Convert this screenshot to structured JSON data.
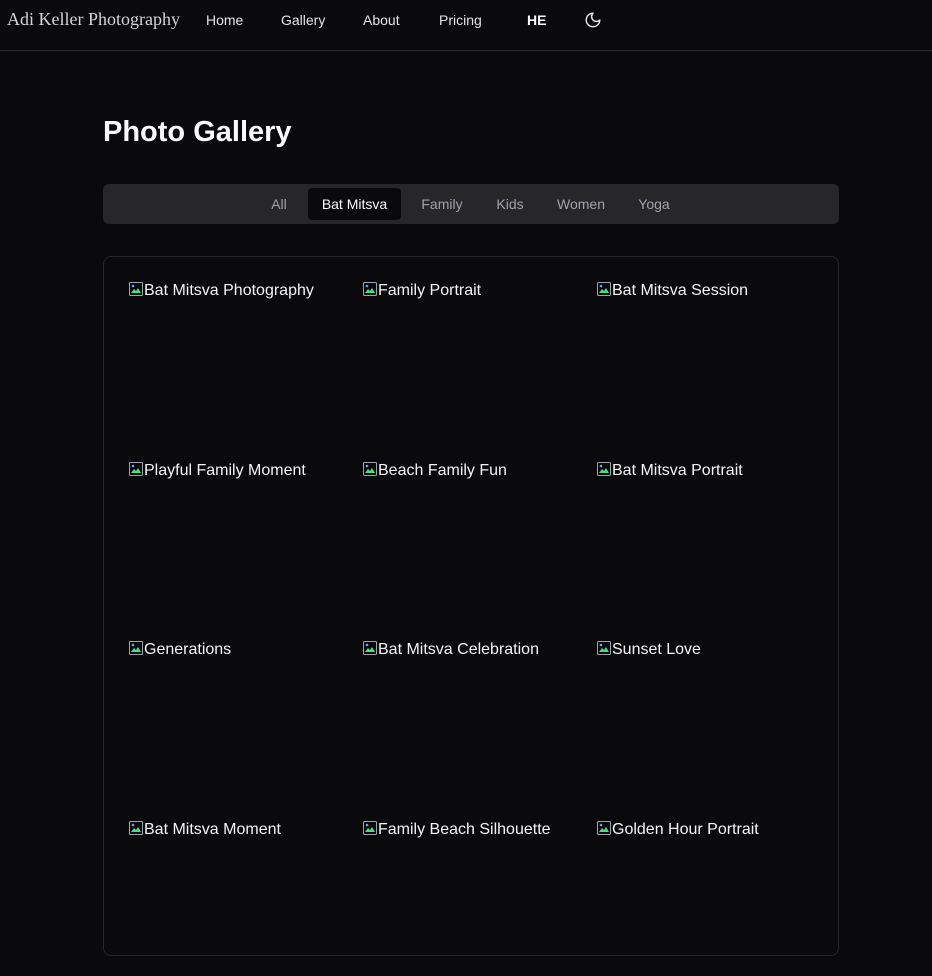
{
  "brand": "Adi Keller Photography",
  "nav": {
    "links": [
      "Home",
      "Gallery",
      "About",
      "Pricing"
    ],
    "lang": "HE",
    "theme_icon": "moon-icon"
  },
  "page": {
    "title": "Photo Gallery"
  },
  "filters": {
    "tabs": [
      "All",
      "Bat Mitsva",
      "Family",
      "Kids",
      "Women",
      "Yoga"
    ],
    "active": "Bat Mitsva"
  },
  "gallery": {
    "items": [
      {
        "alt": "Bat Mitsva Photography"
      },
      {
        "alt": "Family Portrait"
      },
      {
        "alt": "Bat Mitsva Session"
      },
      {
        "alt": "Playful Family Moment"
      },
      {
        "alt": "Beach Family Fun"
      },
      {
        "alt": "Bat Mitsva Portrait"
      },
      {
        "alt": "Generations"
      },
      {
        "alt": "Bat Mitsva Celebration"
      },
      {
        "alt": "Sunset Love"
      },
      {
        "alt": "Bat Mitsva Moment"
      },
      {
        "alt": "Family Beach Silhouette"
      },
      {
        "alt": "Golden Hour Portrait"
      }
    ]
  },
  "colors": {
    "background": "#0a0a0c",
    "tabs_background": "#27272a",
    "border": "#27272a",
    "muted_text": "#a1a1aa"
  }
}
